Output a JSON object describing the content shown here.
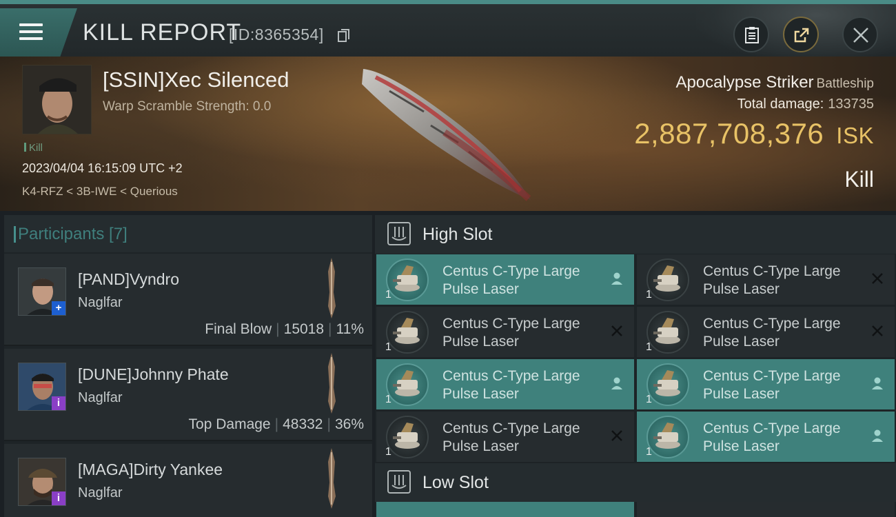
{
  "header": {
    "title": "KILL REPORT",
    "report_id": "[ID:8365354]"
  },
  "victim": {
    "name": "[SSIN]Xec Silenced",
    "warp_scramble": "Warp Scramble Strength: 0.0",
    "tag": "Kill",
    "datetime": "2023/04/04 16:15:09 UTC +2",
    "location": "K4-RFZ < 3B-IWE < Querious",
    "ship": "Apocalypse Striker",
    "ship_class": "Battleship",
    "total_damage_label": "Total damage:",
    "total_damage": "133735",
    "isk_value": "2,887,708,376",
    "isk_unit": "ISK",
    "result": "Kill"
  },
  "participants": {
    "title": "Participants [7]",
    "list": [
      {
        "name": "[PAND]Vyndro",
        "ship": "Naglfar",
        "role": "Final Blow",
        "damage": "15018",
        "percent": "11%",
        "badge": "+"
      },
      {
        "name": "[DUNE]Johnny Phate",
        "ship": "Naglfar",
        "role": "Top Damage",
        "damage": "48332",
        "percent": "36%",
        "badge": "i"
      },
      {
        "name": "[MAGA]Dirty Yankee",
        "ship": "Naglfar",
        "badge": "i"
      }
    ]
  },
  "slots": {
    "high_slot_title": "High Slot",
    "low_slot_title": "Low Slot",
    "high": [
      {
        "name": "Centus C-Type Large Pulse Laser",
        "qty": "1",
        "status": "dropped"
      },
      {
        "name": "Centus C-Type Large Pulse Laser",
        "qty": "1",
        "status": "destroyed"
      },
      {
        "name": "Centus C-Type Large Pulse Laser",
        "qty": "1",
        "status": "destroyed"
      },
      {
        "name": "Centus C-Type Large Pulse Laser",
        "qty": "1",
        "status": "destroyed"
      },
      {
        "name": "Centus C-Type Large Pulse Laser",
        "qty": "1",
        "status": "dropped"
      },
      {
        "name": "Centus C-Type Large Pulse Laser",
        "qty": "1",
        "status": "dropped"
      },
      {
        "name": "Centus C-Type Large Pulse Laser",
        "qty": "1",
        "status": "destroyed"
      },
      {
        "name": "Centus C-Type Large Pulse Laser",
        "qty": "1",
        "status": "dropped"
      }
    ]
  },
  "colors": {
    "accent_teal": "#3f817c",
    "isk_gold": "#e8c266",
    "badge_blue": "#1d5fd0",
    "badge_purple": "#8a3fc6"
  },
  "icons": [
    "menu-icon",
    "copy-icon",
    "clipboard-icon",
    "share-icon",
    "close-icon",
    "slot-icon",
    "person-icon",
    "destroyed-x-icon"
  ]
}
